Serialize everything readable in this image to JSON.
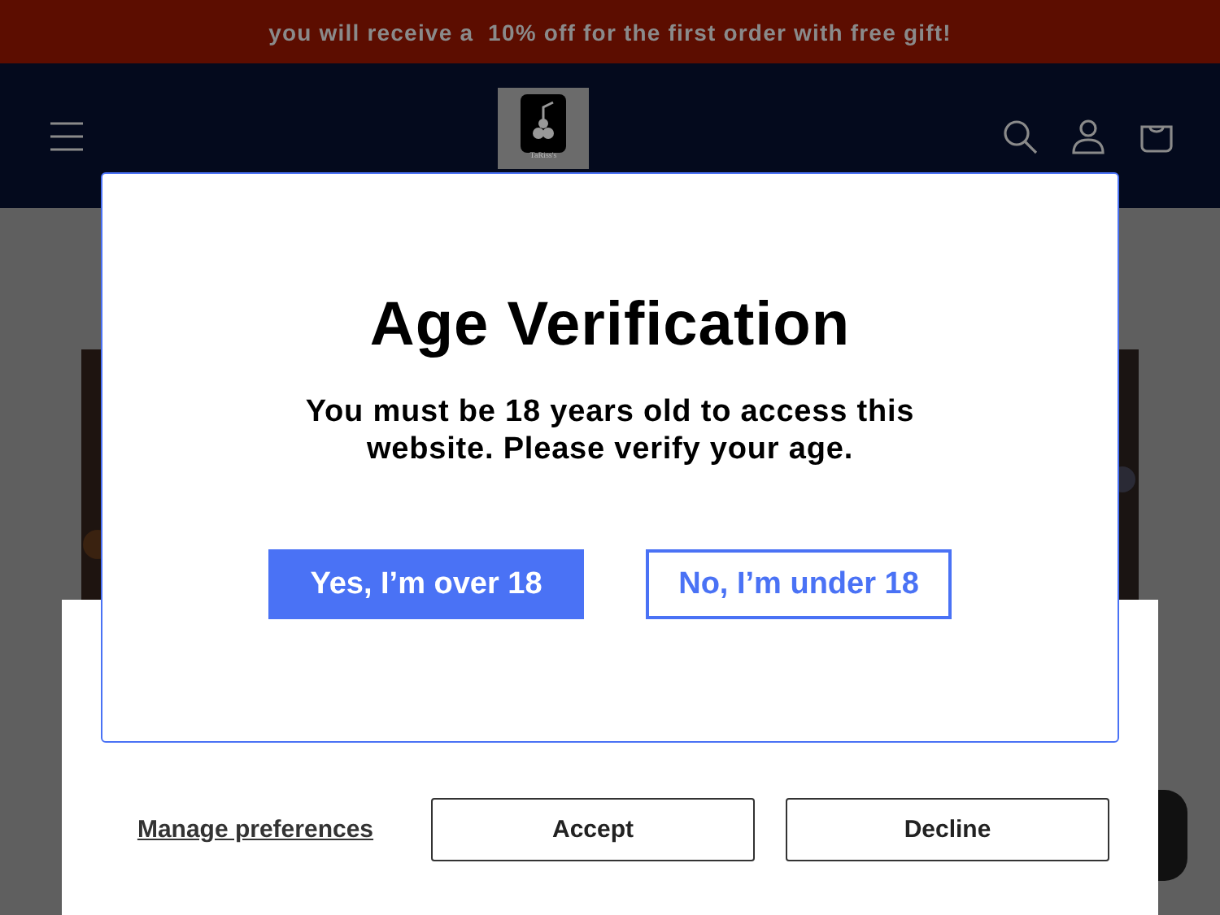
{
  "announcement": "you will receive a  10% off for the first order with free gift!",
  "header": {
    "logo_text": "TaRiss's"
  },
  "cookie_banner": {
    "manage_link": "Manage preferences",
    "buttons": [
      "Accept",
      "Decline"
    ]
  },
  "age_modal": {
    "title": "Age Verification",
    "message": "You must be 18 years old to access this website. Please verify your age.",
    "buttons": [
      {
        "label": "Yes, I’m over 18",
        "kind": "primary"
      },
      {
        "label": "No, I’m under 18",
        "kind": "outline"
      }
    ]
  }
}
